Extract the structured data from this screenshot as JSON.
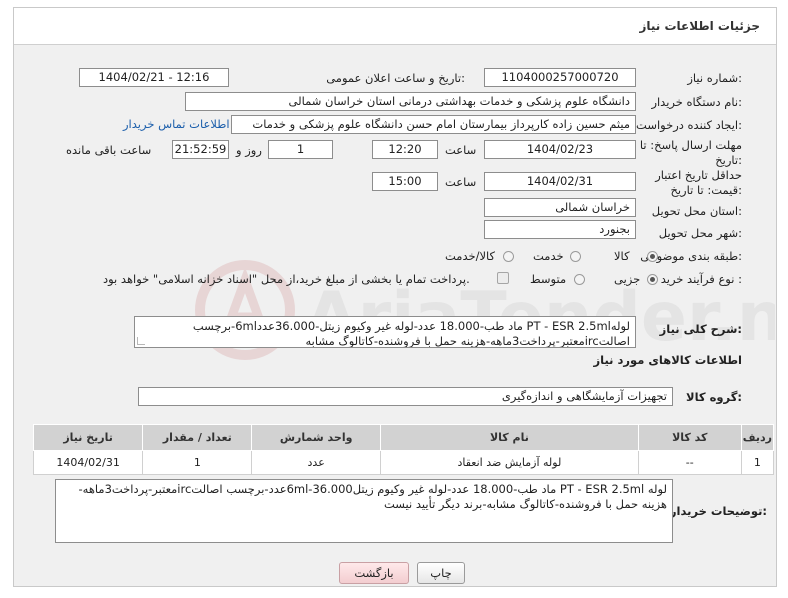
{
  "header": {
    "title": "جزئیات اطلاعات نیاز"
  },
  "form": {
    "need_number": {
      "label": "شماره نیاز:",
      "value": "1104000257000720"
    },
    "announce_datetime": {
      "label": "تاریخ و ساعت اعلان عمومی:",
      "value": "1404/02/21 - 12:16"
    },
    "buyer_org": {
      "label": "نام دستگاه خریدار:",
      "value": "دانشگاه علوم پزشکی و خدمات بهداشتی درمانی استان خراسان شمالی"
    },
    "requester": {
      "label": "ایجاد کننده درخواست:",
      "value": "میثم  حسین زاده  کارپرداز بیمارستان امام حسن دانشگاه علوم پزشکی و خدمات",
      "contact_link": "اطلاعات تماس خریدار"
    },
    "reply_deadline": {
      "label": "مهلت ارسال پاسخ: تا تاریخ:",
      "date": "1404/02/23",
      "time_label": "ساعت",
      "time": "12:20",
      "days": "1",
      "days_label": "روز و",
      "remaining": "21:52:59",
      "remaining_label": "ساعت باقی مانده"
    },
    "price_validity": {
      "label": "حداقل تاریخ اعتبار قیمت: تا تاریخ:",
      "date": "1404/02/31",
      "time_label": "ساعت",
      "time": "15:00"
    },
    "delivery_province": {
      "label": "استان محل تحویل:",
      "value": "خراسان شمالی"
    },
    "delivery_city": {
      "label": "شهر محل تحویل:",
      "value": "بجنورد"
    },
    "category": {
      "label": "طبقه بندی موضوعی:",
      "options": [
        "کالا",
        "خدمت",
        "کالا/خدمت"
      ],
      "selected": "کالا"
    },
    "purchase_process": {
      "label": "نوع فرآیند خرید :",
      "options": [
        "جزیی",
        "متوسط"
      ],
      "selected": "جزیی",
      "payment_note": "پرداخت تمام یا بخشی از مبلغ خرید،از محل \"اسناد خزانه اسلامی\" خواهد بود."
    },
    "description": {
      "label": "شرح کلی نیاز:",
      "value": "لولهPT - ESR 2.5ml ماد طب-18.000 عدد-لوله غیر وکیوم زیتل-36.000عدد6ml-برچسب اصالتircمعتبر-پرداخت3ماهه-هزینه حمل با فروشنده-کاتالوگ مشابه"
    }
  },
  "items_section": {
    "title": "اطلاعات کالاهای مورد نیاز",
    "group_label": "گروه کالا:",
    "group_value": "تجهیزات آزمایشگاهی و اندازه‌گیری",
    "columns": [
      "ردیف",
      "کد کالا",
      "نام کالا",
      "واحد شمارش",
      "تعداد / مقدار",
      "تاریخ نیاز"
    ],
    "rows": [
      {
        "row": "1",
        "code": "--",
        "name": "لوله آزمایش ضد انعقاد",
        "unit": "عدد",
        "qty": "1",
        "date": "1404/02/31"
      }
    ]
  },
  "buyer_notes": {
    "label": "توضیحات خریدار:",
    "value": "لوله PT - ESR 2.5ml ماد طب-18.000 عدد-لوله غیر وکیوم زیتل6ml-36.000عدد-برچسب اصالتircمعتبر-پرداخت3ماهه-هزینه حمل با فروشنده-کاتالوگ مشابه-برند دیگر تأیید نیست"
  },
  "buttons": {
    "print": "چاپ",
    "back": "بازگشت"
  },
  "watermark_text": "AriaTender.net"
}
